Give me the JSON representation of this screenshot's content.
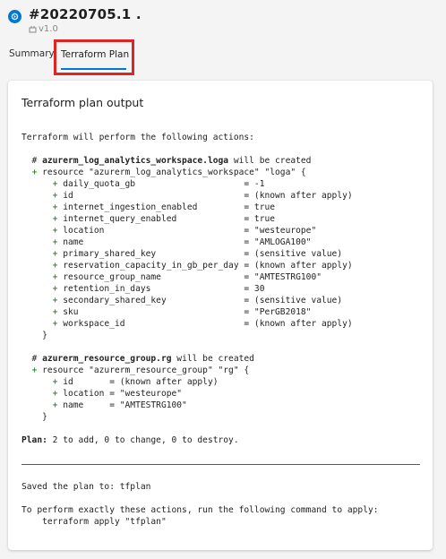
{
  "header": {
    "run_title": "#20220705.1 .",
    "version": "v1.0"
  },
  "tabs": [
    {
      "label": "Summary",
      "selected": false
    },
    {
      "label": "Terraform Plan",
      "selected": true
    }
  ],
  "colors": {
    "accent": "#0078d4",
    "highlight_box": "#e02424",
    "plus": "#107c10"
  },
  "card": {
    "title": "Terraform plan output"
  },
  "log_lines": [
    {
      "kind": "text",
      "text": "Terraform will perform the following actions:"
    },
    {
      "kind": "blank"
    },
    {
      "kind": "comment",
      "prefix": "  # ",
      "bold": "azurerm_log_analytics_workspace.loga",
      "text": " will be created"
    },
    {
      "kind": "plus",
      "indent": "  ",
      "text": " resource \"azurerm_log_analytics_workspace\" \"loga\" {"
    },
    {
      "kind": "plus",
      "indent": "      ",
      "text": " daily_quota_gb                     = -1"
    },
    {
      "kind": "plus",
      "indent": "      ",
      "text": " id                                 = (known after apply)"
    },
    {
      "kind": "plus",
      "indent": "      ",
      "text": " internet_ingestion_enabled         = true"
    },
    {
      "kind": "plus",
      "indent": "      ",
      "text": " internet_query_enabled             = true"
    },
    {
      "kind": "plus",
      "indent": "      ",
      "text": " location                           = \"westeurope\""
    },
    {
      "kind": "plus",
      "indent": "      ",
      "text": " name                               = \"AMLOGA100\""
    },
    {
      "kind": "plus",
      "indent": "      ",
      "text": " primary_shared_key                 = (sensitive value)"
    },
    {
      "kind": "plus",
      "indent": "      ",
      "text": " reservation_capacity_in_gb_per_day = (known after apply)"
    },
    {
      "kind": "plus",
      "indent": "      ",
      "text": " resource_group_name                = \"AMTESTRG100\""
    },
    {
      "kind": "plus",
      "indent": "      ",
      "text": " retention_in_days                  = 30"
    },
    {
      "kind": "plus",
      "indent": "      ",
      "text": " secondary_shared_key               = (sensitive value)"
    },
    {
      "kind": "plus",
      "indent": "      ",
      "text": " sku                                = \"PerGB2018\""
    },
    {
      "kind": "plus",
      "indent": "      ",
      "text": " workspace_id                       = (known after apply)"
    },
    {
      "kind": "text",
      "text": "    }"
    },
    {
      "kind": "blank"
    },
    {
      "kind": "comment",
      "prefix": "  # ",
      "bold": "azurerm_resource_group.rg",
      "text": " will be created"
    },
    {
      "kind": "plus",
      "indent": "  ",
      "text": " resource \"azurerm_resource_group\" \"rg\" {"
    },
    {
      "kind": "plus",
      "indent": "      ",
      "text": " id       = (known after apply)"
    },
    {
      "kind": "plus",
      "indent": "      ",
      "text": " location = \"westeurope\""
    },
    {
      "kind": "plus",
      "indent": "      ",
      "text": " name     = \"AMTESTRG100\""
    },
    {
      "kind": "text",
      "text": "    }"
    },
    {
      "kind": "blank"
    },
    {
      "kind": "summary",
      "bold": "Plan:",
      "text": " 2 to add, 0 to change, 0 to destroy."
    },
    {
      "kind": "blank"
    },
    {
      "kind": "rule"
    },
    {
      "kind": "blank"
    },
    {
      "kind": "text",
      "text": "Saved the plan to: tfplan"
    },
    {
      "kind": "blank"
    },
    {
      "kind": "text",
      "text": "To perform exactly these actions, run the following command to apply:"
    },
    {
      "kind": "text",
      "text": "    terraform apply \"tfplan\""
    }
  ]
}
